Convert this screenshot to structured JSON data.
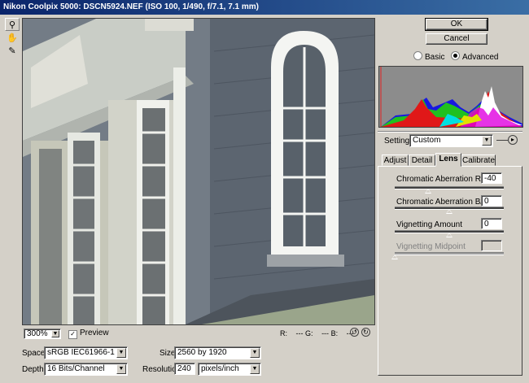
{
  "window": {
    "title": "Nikon Coolpix 5000:  DSCN5924.NEF  (ISO 100, 1/490, f/7.1, 7.1 mm)"
  },
  "tools": [
    {
      "name": "zoom-tool",
      "glyph": "🔍"
    },
    {
      "name": "hand-tool",
      "glyph": "✋"
    },
    {
      "name": "eyedropper-tool",
      "glyph": "✎"
    }
  ],
  "buttons": {
    "ok": "OK",
    "cancel": "Cancel"
  },
  "mode": {
    "basic": "Basic",
    "advanced": "Advanced",
    "selected": "advanced"
  },
  "settings": {
    "label": "Settings:",
    "value": "Custom"
  },
  "tabs": [
    "Adjust",
    "Detail",
    "Lens",
    "Calibrate"
  ],
  "active_tab": "Lens",
  "lens": {
    "chromatic_rc": {
      "label": "Chromatic Aberration R/C",
      "value": "-40",
      "slider_fraction": 0.3
    },
    "chromatic_by": {
      "label": "Chromatic Aberration B/Y",
      "value": "0",
      "slider_fraction": 0.5
    },
    "vignetting_amount": {
      "label": "Vignetting Amount",
      "value": "0",
      "slider_fraction": 0.5
    },
    "vignetting_midpoint": {
      "label": "Vignetting Midpoint",
      "value": "",
      "slider_fraction": 0.0
    }
  },
  "zoom": {
    "value": "300%",
    "options_arrow": "▼"
  },
  "preview_toggle": {
    "label": "Preview",
    "checked": true
  },
  "readout": {
    "r": "R:",
    "r_val": "---",
    "g": "G:",
    "g_val": "---",
    "b": "B:",
    "b_val": "---"
  },
  "workflow": {
    "space_label": "Space:",
    "space_value": "sRGB IEC61966-1",
    "depth_label": "Depth:",
    "depth_value": "16 Bits/Channel",
    "size_label": "Size:",
    "size_value": "2560 by 1920",
    "resolution_label": "Resolution:",
    "resolution_value": "240",
    "resolution_unit": "pixels/inch"
  },
  "colors": {
    "title_bar": "#0a246a",
    "window_bg": "#d4d0c8",
    "histogram_bg": "#8c8c8c"
  }
}
